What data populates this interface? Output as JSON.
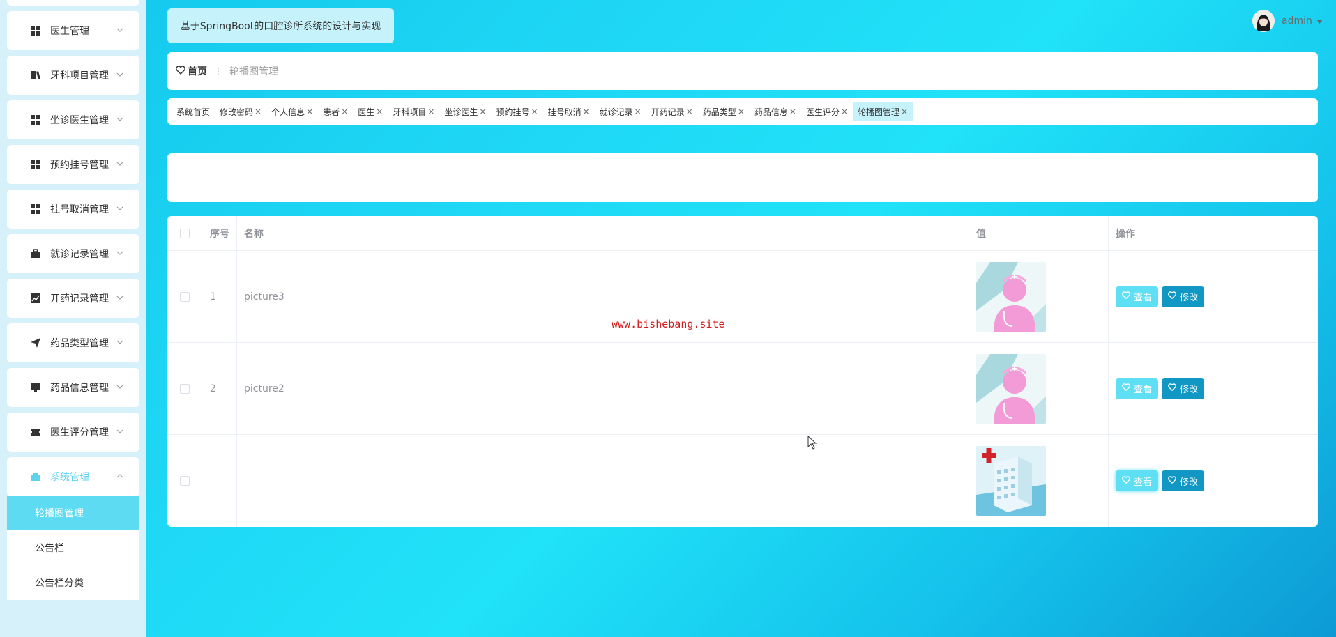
{
  "app": {
    "title": "基于SpringBoot的口腔诊所系统的设计与实现",
    "user": "admin"
  },
  "sidebar": {
    "items": [
      {
        "label": "医生管理",
        "icon": "grid-icon"
      },
      {
        "label": "牙科项目管理",
        "icon": "book-icon"
      },
      {
        "label": "坐诊医生管理",
        "icon": "grid-icon"
      },
      {
        "label": "预约挂号管理",
        "icon": "grid-icon"
      },
      {
        "label": "挂号取消管理",
        "icon": "grid-icon"
      },
      {
        "label": "就诊记录管理",
        "icon": "briefcase-icon"
      },
      {
        "label": "开药记录管理",
        "icon": "chart-icon"
      },
      {
        "label": "药品类型管理",
        "icon": "send-icon"
      },
      {
        "label": "药品信息管理",
        "icon": "monitor-icon"
      },
      {
        "label": "医生评分管理",
        "icon": "ticket-icon"
      },
      {
        "label": "系统管理",
        "icon": "box-icon"
      }
    ],
    "submenu": [
      {
        "label": "轮播图管理"
      },
      {
        "label": "公告栏"
      },
      {
        "label": "公告栏分类"
      }
    ]
  },
  "breadcrumb": {
    "home": "首页",
    "separator": "⋮",
    "current": "轮播图管理"
  },
  "tabs": [
    {
      "label": "系统首页",
      "closable": false
    },
    {
      "label": "修改密码",
      "closable": true
    },
    {
      "label": "个人信息",
      "closable": true
    },
    {
      "label": "患者",
      "closable": true
    },
    {
      "label": "医生",
      "closable": true
    },
    {
      "label": "牙科项目",
      "closable": true
    },
    {
      "label": "坐诊医生",
      "closable": true
    },
    {
      "label": "预约挂号",
      "closable": true
    },
    {
      "label": "挂号取消",
      "closable": true
    },
    {
      "label": "就诊记录",
      "closable": true
    },
    {
      "label": "开药记录",
      "closable": true
    },
    {
      "label": "药品类型",
      "closable": true
    },
    {
      "label": "药品信息",
      "closable": true
    },
    {
      "label": "医生评分",
      "closable": true
    },
    {
      "label": "轮播图管理",
      "closable": true
    }
  ],
  "table": {
    "headers": {
      "index": "序号",
      "name": "名称",
      "value": "值",
      "ops": "操作"
    },
    "rows": [
      {
        "index": "1",
        "name": "picture3",
        "image": "doctor-avatar"
      },
      {
        "index": "2",
        "name": "picture2",
        "image": "doctor-avatar"
      },
      {
        "index": "",
        "name": "",
        "image": "hospital-building"
      }
    ],
    "actions": {
      "view": "查看",
      "edit": "修改"
    }
  },
  "watermark": "www.bishebang.site",
  "colors": {
    "accent": "#5cdbf2",
    "edit_button": "#1097c3",
    "view_button": "#5fdff3",
    "background": "#1fd8f5"
  }
}
